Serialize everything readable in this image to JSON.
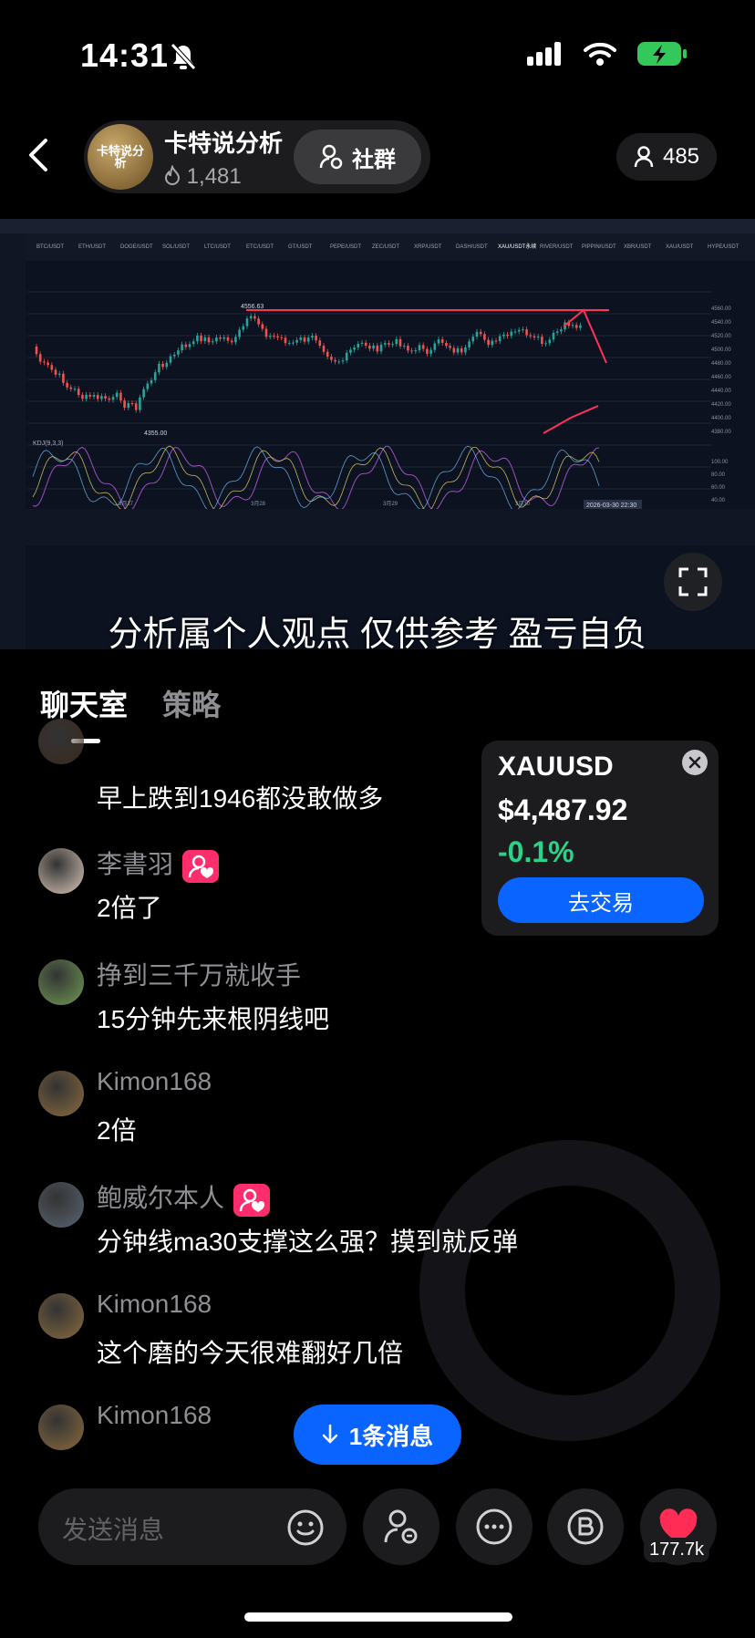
{
  "status_bar": {
    "time": "14:31"
  },
  "header": {
    "back_label": "",
    "channel_name": "卡特说分析",
    "logo_text": "卡特说分析",
    "fans": "1,481",
    "community_label": "社群",
    "viewer_count": "485"
  },
  "video": {
    "subtitle": "分析属个人观点 仅供参考 盈亏自负",
    "tickers": [
      "BTC/USDT",
      "ETH/USDT",
      "DOGE/USDT",
      "SOL/USDT",
      "LTC/USDT",
      "ETC/USDT",
      "GT/USDT",
      "PEPE/USDT",
      "ZEC/USDT",
      "XRP/USDT",
      "DASH/USDT",
      "XAU/USDT永续",
      "RIVER/USDT",
      "PIPPIN/USDT",
      "XBR/USDT",
      "XAU/USDT",
      "HYPE/USDT"
    ],
    "price_labels": [
      "4560.00",
      "4540.00",
      "4520.00",
      "4500.00",
      "4480.00",
      "4460.00",
      "4440.00",
      "4420.00",
      "4400.00",
      "4380.00"
    ],
    "osc_labels": [
      "100.00",
      "80.00",
      "60.00",
      "40.00",
      "20.00",
      "0.00"
    ],
    "date_labels": [
      "3月27",
      "3月28",
      "3月29",
      "3月30"
    ],
    "high_marker": "4556.63",
    "low_marker": "4355.00",
    "kdj_label": "KDJ(9,3,3)",
    "timestamp": "2026-03-30 22:30"
  },
  "tabs": [
    {
      "label": "聊天室"
    },
    {
      "label": "策略"
    }
  ],
  "messages": [
    {
      "name": "",
      "text": "早上跌到1946都没敢做多",
      "avatar_color": "#3a2a20",
      "badge": false
    },
    {
      "name": "李書羽",
      "text": "2倍了",
      "avatar_color": "#d9c6b8",
      "badge": true
    },
    {
      "name": "挣到三千万就收手",
      "text": "15分钟先来根阴线吧",
      "avatar_color": "#6f9a55",
      "badge": false
    },
    {
      "name": "Kimon168",
      "text": "2倍",
      "avatar_color": "#8a6a3e",
      "badge": false
    },
    {
      "name": "鲍威尔本人",
      "text": "分钟线ma30支撑这么强？摸到就反弹",
      "avatar_color": "#5a6472",
      "badge": true
    },
    {
      "name": "Kimon168",
      "text": "这个磨的今天很难翻好几倍",
      "avatar_color": "#8a6a3e",
      "badge": false
    },
    {
      "name": "Kimon168",
      "text": "",
      "avatar_color": "#8a6a3e",
      "badge": false
    }
  ],
  "quote_card": {
    "symbol": "XAUUSD",
    "price": "$4,487.92",
    "change": "-0.1%",
    "trade_label": "去交易"
  },
  "new_messages_label": "1条消息",
  "input": {
    "placeholder": "发送消息"
  },
  "likes": "177.7k",
  "colors": {
    "accent": "#0a64ff",
    "up": "#2ed18a",
    "badge": "#ff2d6b",
    "like": "#ff2d55"
  }
}
